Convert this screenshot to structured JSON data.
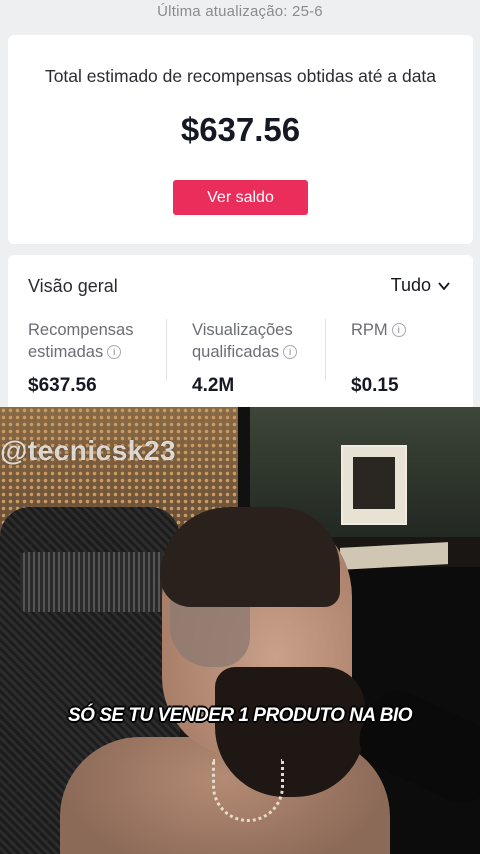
{
  "header": {
    "last_update": "Última atualização: 25-6"
  },
  "total_card": {
    "label": "Total estimado de recompensas obtidas até a data",
    "value": "$637.56",
    "button_label": "Ver saldo",
    "accent_color": "#ea2d5a"
  },
  "overview": {
    "title": "Visão geral",
    "filter_label": "Tudo",
    "filter_icon": "chevron-down-icon",
    "metrics": [
      {
        "label_line1": "Recompensas",
        "label_line2": "estimadas",
        "value": "$637.56",
        "icon": "info-icon"
      },
      {
        "label_line1": "Visualizações",
        "label_line2": "qualificadas",
        "value": "4.2M",
        "icon": "info-icon"
      },
      {
        "label_line1": "RPM",
        "label_line2": "",
        "value": "$0.15",
        "icon": "info-icon"
      }
    ]
  },
  "video": {
    "watermark": "@tecnicsk23",
    "caption": "SÓ SE TU VENDER 1 PRODUTO NA BIO"
  }
}
